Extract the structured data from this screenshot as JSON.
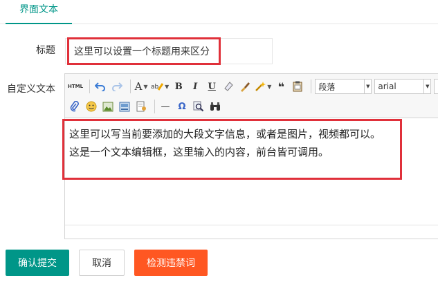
{
  "tab": {
    "active_label": "界面文本"
  },
  "form": {
    "title_label": "标题",
    "title_value": "这里可以设置一个标题用来区分",
    "custom_label": "自定义文本"
  },
  "editor": {
    "toolbar": {
      "html_label": "HTML",
      "font_color_label": "A",
      "bold_label": "B",
      "italic_label": "I",
      "underline_label": "U",
      "quote_label": "❝",
      "paragraph_select": "段落",
      "font_select": "arial",
      "hr_label": "—",
      "omega_label": "Ω"
    },
    "content_lines": [
      "这里可以写当前要添加的大段文字信息，或者是图片，视频都可以。",
      "这是一个文本编辑框，这里输入的内容，前台皆可调用。"
    ]
  },
  "buttons": {
    "submit": "确认提交",
    "cancel": "取消",
    "check": "检测违禁词"
  },
  "colors": {
    "primary": "#009688",
    "danger": "#ff5722",
    "highlight": "#e0303a"
  }
}
